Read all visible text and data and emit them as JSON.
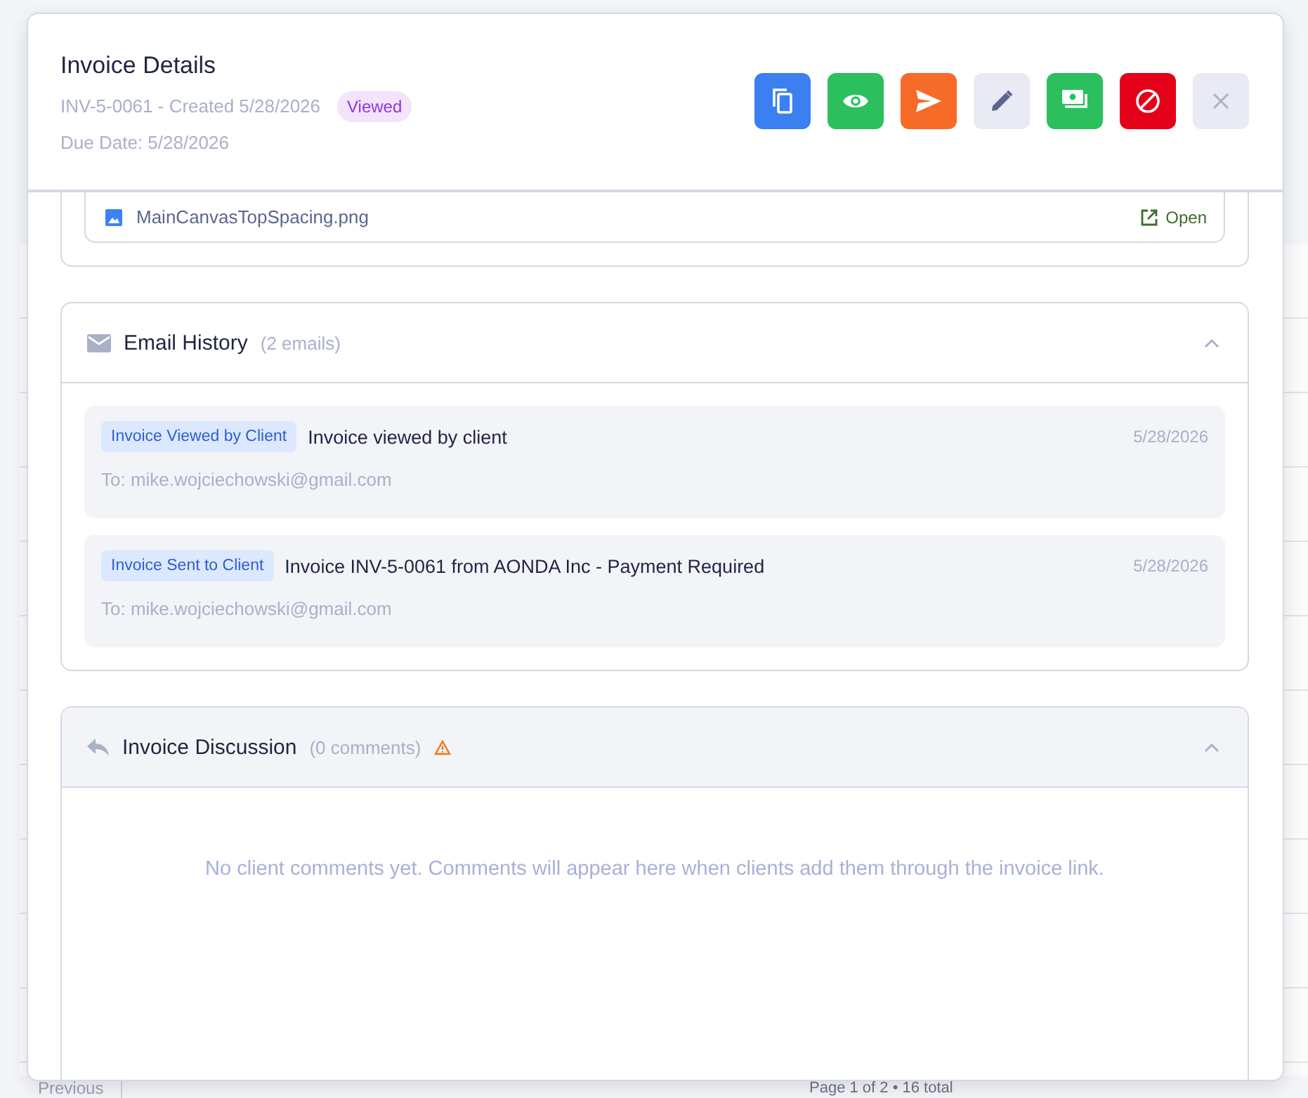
{
  "modal": {
    "title": "Invoice Details",
    "reference": "INV-5-0061 - Created 5/28/2026",
    "status": "Viewed",
    "due_date": "Due Date: 5/28/2026",
    "actions": [
      {
        "kind": "duplicate"
      },
      {
        "kind": "view"
      },
      {
        "kind": "send"
      },
      {
        "kind": "edit"
      },
      {
        "kind": "payment"
      },
      {
        "kind": "void"
      },
      {
        "kind": "close"
      }
    ]
  },
  "attachment": {
    "filename": "MainCanvasTopSpacing.png",
    "open_label": "Open"
  },
  "email_history": {
    "title": "Email History",
    "count": "(2 emails)",
    "expanded": true,
    "emails": [
      {
        "tag": "Invoice Viewed by Client",
        "subject": "Invoice viewed by client",
        "to": "To: mike.wojciechowski@gmail.com",
        "date": "5/28/2026"
      },
      {
        "tag": "Invoice Sent to Client",
        "subject": "Invoice INV-5-0061 from AONDA Inc - Payment Required",
        "to": "To: mike.wojciechowski@gmail.com",
        "date": "5/28/2026"
      }
    ]
  },
  "discussion": {
    "title": "Invoice Discussion",
    "count": "(0 comments)",
    "warning": true,
    "expanded": true,
    "empty_text": "No client comments yet. Comments will appear here when clients add them through the invoice link."
  },
  "pagination": {
    "previous": "Previous",
    "page_info": "Page 1 of 2 • 16 total"
  }
}
